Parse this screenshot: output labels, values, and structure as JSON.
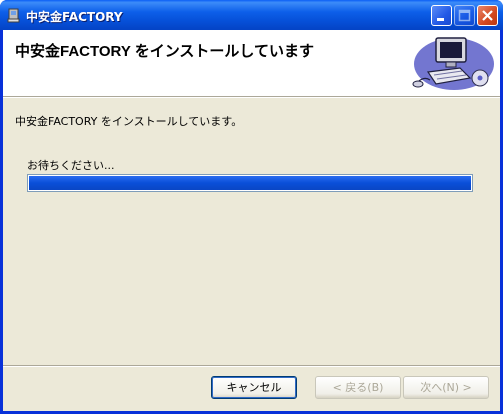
{
  "window": {
    "title": "中安金FACTORY"
  },
  "banner": {
    "title": "中安金FACTORY をインストールしています"
  },
  "body": {
    "status": "中安金FACTORY をインストールしています。",
    "wait_label": "お待ちください..."
  },
  "progress": {
    "value": 1.0
  },
  "buttons": {
    "cancel": "キャンセル",
    "back": "< 戻る(B)",
    "next": "次へ(N) >"
  }
}
